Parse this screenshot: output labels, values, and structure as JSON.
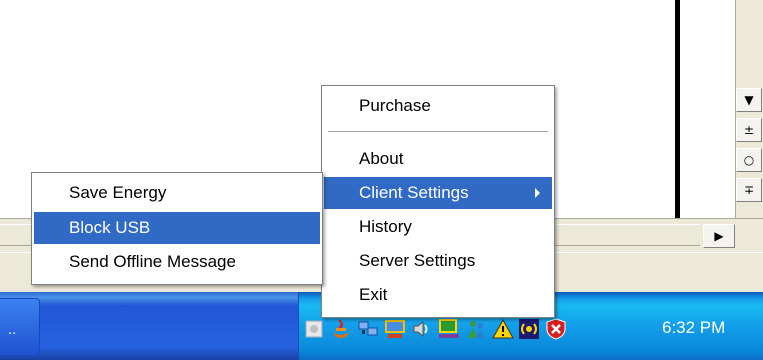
{
  "main_menu": {
    "items": [
      {
        "label": "Purchase"
      },
      {
        "label": "About"
      },
      {
        "label": "Client Settings",
        "has_submenu": true,
        "selected": true
      },
      {
        "label": "History"
      },
      {
        "label": "Server Settings"
      },
      {
        "label": "Exit"
      }
    ]
  },
  "submenu": {
    "items": [
      {
        "label": "Save Energy"
      },
      {
        "label": "Block USB",
        "selected": true
      },
      {
        "label": "Send Offline Message"
      }
    ]
  },
  "taskbar": {
    "task_button_label": "..",
    "clock": "6:32 PM"
  },
  "tray_icons": [
    "tray-app-icon",
    "java-icon",
    "network-icon",
    "display-icon",
    "volume-icon",
    "monitor-icon",
    "messenger-icon",
    "warning-icon",
    "wireless-icon",
    "security-shield-icon"
  ],
  "scroll_buttons": {
    "down": "▼",
    "prev_page": "±",
    "select_browse": "○",
    "next_page": "∓",
    "right": "▶"
  },
  "colors": {
    "selection": "#316ac5",
    "taskbar": "#2157d7",
    "tray": "#139eea"
  }
}
